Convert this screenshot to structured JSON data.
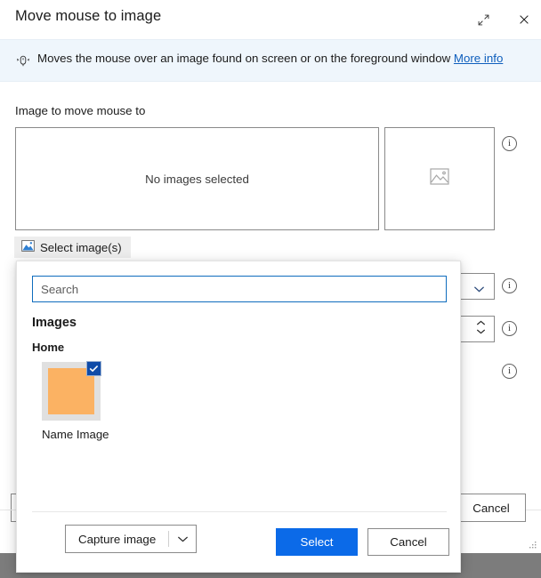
{
  "window": {
    "title": "Move mouse to image",
    "expand_icon": "expand-diagonal-icon",
    "close_icon": "close-icon"
  },
  "info_banner": {
    "icon": "mouse-pointer-icon",
    "text": "Moves the mouse over an image found on screen or on the foreground window",
    "link_label": "More info"
  },
  "main": {
    "field_label": "Image to move mouse to",
    "empty_state_text": "No images selected",
    "preview_icon": "picture-placeholder-icon",
    "select_images_button": {
      "label": "Select image(s)",
      "icon": "picture-icon"
    },
    "info_icon": "info-icon",
    "dropdown_chevron_icon": "chevron-down-icon",
    "spinner_icon": "spinner-up-down-icon",
    "cancel_label": "Cancel",
    "resize_grip_icon": "resize-grip-icon"
  },
  "flyout": {
    "search": {
      "value": "",
      "placeholder": "Search"
    },
    "section_title": "Images",
    "group_label": "Home",
    "items": [
      {
        "label": "Name Image",
        "selected": true,
        "swatch_color": "#fbb263",
        "check_icon": "checkmark-icon"
      }
    ],
    "capture_button": {
      "label": "Capture image",
      "chevron_icon": "chevron-down-icon"
    },
    "select_label": "Select",
    "cancel_label": "Cancel"
  },
  "colors": {
    "accent": "#0b6ae8",
    "link": "#0f5fbd",
    "banner_bg": "#eff6fc",
    "check_bg": "#0f4ba8",
    "swatch": "#fbb263"
  }
}
